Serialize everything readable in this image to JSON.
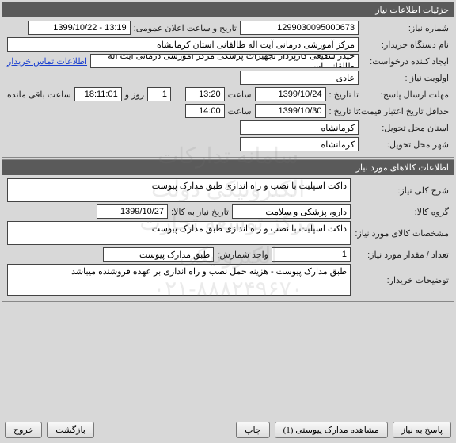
{
  "panel1": {
    "title": "جزئیات اطلاعات نیاز",
    "need_number_label": "شماره نیاز:",
    "need_number": "1299030095000673",
    "anndate_label": "تاریخ و ساعت اعلان عمومی:",
    "anndate": "13:19 - 1399/10/22",
    "buyer_label": "نام دستگاه خریدار:",
    "buyer": "مرکز آموزشی درمانی آیت اله طالقانی استان کرمانشاه",
    "creator_label": "ایجاد کننده درخواست:",
    "creator": "حیدر شفیعی کارپرداز تجهیزات پزشکی مرکز آموزشی درمانی آیت اله طالقانی اس",
    "contact_link": "اطلاعات تماس خریدار",
    "priority_label": "اولویت نیاز :",
    "priority": "عادی",
    "deadline_label": "مهلت ارسال پاسخ:",
    "deadline_to_label": "تا تاریخ :",
    "deadline_date": "1399/10/24",
    "deadline_time_label": "ساعت",
    "deadline_time": "13:20",
    "remain_day": "1",
    "remain_day_label": "روز و",
    "remain_time": "18:11:01",
    "remain_time_label": "ساعت باقی مانده",
    "price_validity_label": "حداقل تاریخ اعتبار قیمت:",
    "price_validity_to_label": "تا تاریخ :",
    "price_validity_date": "1399/10/30",
    "price_validity_time_label": "ساعت",
    "price_validity_time": "14:00",
    "province_label": "استان محل تحویل:",
    "province": "کرمانشاه",
    "city_label": "شهر محل تحویل:",
    "city": "کرمانشاه"
  },
  "panel2": {
    "title": "اطلاعات کالاهای مورد نیاز",
    "general_desc_label": "شرح کلی نیاز:",
    "general_desc": "داکت اسپلیت با نصب و راه اندازی طبق مدارک پیوست",
    "group_label": "گروه کالا:",
    "group": "دارو، پزشکی و سلامت",
    "need_date_label": "تاریخ نیاز به کالا:",
    "need_date": "1399/10/27",
    "spec_label": "مشخصات کالای مورد نیاز:",
    "spec": "داکت اسپلیت با نصب و راه اندازی طبق مدارک پیوست",
    "qty_label": "تعداد / مقدار مورد نیاز:",
    "qty": "1",
    "unit_label": "واحد شمارش:",
    "unit": "طبق مدارک پیوست",
    "buyer_notes_label": "توضیحات خریدار:",
    "buyer_notes": "طبق مدارک پیوست - هزینه حمل نصب و راه اندازی بر عهده فروشنده میباشد"
  },
  "footer": {
    "respond": "پاسخ به نیاز",
    "attachments": "مشاهده مدارک پیوستی (1)",
    "print": "چاپ",
    "back": "بازگشت",
    "exit": "خروج"
  },
  "watermark": {
    "line1": "سامانه تدارکات الکترونیکی دولت",
    "line2": "مرکز توسعه تجارت الکترونیکی",
    "line3": "۰۲۱-۸۸۸۲۴۹۶۷۰"
  }
}
